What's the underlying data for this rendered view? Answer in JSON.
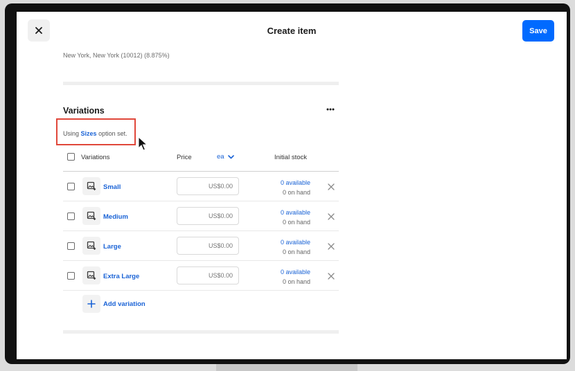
{
  "header": {
    "title": "Create item",
    "save_label": "Save"
  },
  "tax": {
    "location": "New York, New York (10012) (8.875%)"
  },
  "variations": {
    "title": "Variations",
    "option_set_prefix": "Using",
    "option_set_name": "Sizes",
    "option_set_suffix": "option set.",
    "columns": {
      "name": "Variations",
      "price": "Price",
      "unit": "ea",
      "stock": "Initial stock"
    },
    "rows": [
      {
        "name": "Small",
        "price_placeholder": "US$0.00",
        "available": "0 available",
        "on_hand": "0 on hand"
      },
      {
        "name": "Medium",
        "price_placeholder": "US$0.00",
        "available": "0 available",
        "on_hand": "0 on hand"
      },
      {
        "name": "Large",
        "price_placeholder": "US$0.00",
        "available": "0 available",
        "on_hand": "0 on hand"
      },
      {
        "name": "Extra Large",
        "price_placeholder": "US$0.00",
        "available": "0 available",
        "on_hand": "0 on hand"
      }
    ],
    "add_label": "Add variation"
  },
  "icons": {
    "close": "close-icon",
    "more": "more-horizontal-icon",
    "image": "image-add-icon",
    "remove": "remove-x-icon",
    "add": "plus-icon",
    "chevron": "chevron-down-icon"
  },
  "colors": {
    "accent": "#006aff",
    "link": "#1a63d6",
    "highlight_border": "#e0473a"
  }
}
